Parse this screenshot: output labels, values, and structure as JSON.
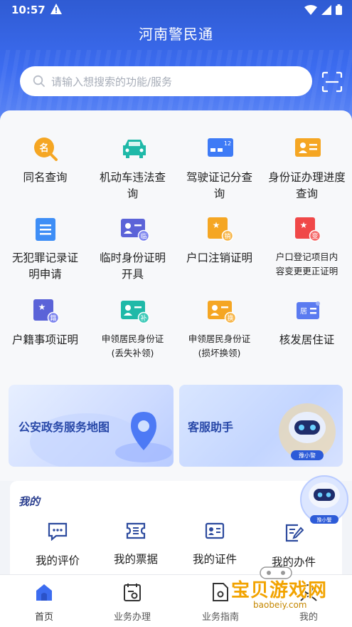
{
  "status_bar": {
    "time": "10:57"
  },
  "header": {
    "title": "河南警民通"
  },
  "search": {
    "placeholder": "请输入想搜索的功能/服务"
  },
  "services": [
    {
      "label": "同名查询",
      "icon": "search-name-icon",
      "color": "#f5a623"
    },
    {
      "label": "机动车违法查询",
      "icon": "car-icon",
      "color": "#1fb9a8"
    },
    {
      "label": "驾驶证记分查询",
      "icon": "license-icon",
      "color": "#3e7bf6",
      "badge": "12"
    },
    {
      "label": "身份证办理进度查询",
      "icon": "id-card-icon",
      "color": "#f5a623"
    },
    {
      "label": "无犯罪记录证明申请",
      "icon": "document-icon",
      "color": "#3e8ef6"
    },
    {
      "label": "临时身份证明开具",
      "icon": "temp-id-icon",
      "color": "#5b63d8",
      "badge": "临"
    },
    {
      "label": "户口注销证明",
      "icon": "household-cancel-icon",
      "color": "#f5a623",
      "badge": "销"
    },
    {
      "label": "户口登记项目内容变更更正证明",
      "icon": "household-change-icon",
      "color": "#f04848",
      "badge": "变"
    },
    {
      "label": "户籍事项证明",
      "icon": "household-record-icon",
      "color": "#5b63d8",
      "badge": "籍"
    },
    {
      "label": "申领居民身份证(丢失补领)",
      "icon": "id-reissue-icon",
      "color": "#1fb9a8",
      "badge": "补"
    },
    {
      "label": "申领居民身份证(损坏换领)",
      "icon": "id-replace-icon",
      "color": "#f5a623",
      "badge": "换"
    },
    {
      "label": "核发居住证",
      "icon": "residence-permit-icon",
      "color": "#5b7bf0",
      "badge": "居"
    }
  ],
  "banners": {
    "map": "公安政务服务地图",
    "assistant": "客服助手",
    "robot_name": "豫小警"
  },
  "mine": {
    "title": "我的",
    "items": [
      {
        "label": "我的评价",
        "icon": "comment-icon"
      },
      {
        "label": "我的票据",
        "icon": "ticket-icon"
      },
      {
        "label": "我的证件",
        "icon": "certificate-icon"
      },
      {
        "label": "我的办件",
        "icon": "edit-doc-icon"
      }
    ]
  },
  "tabbar": {
    "items": [
      {
        "label": "首页",
        "icon": "home-icon"
      },
      {
        "label": "业务办理",
        "icon": "business-icon"
      },
      {
        "label": "业务指南",
        "icon": "guide-icon"
      },
      {
        "label": "我的",
        "icon": "user-icon"
      }
    ]
  },
  "watermark": {
    "text": "宝贝游戏网",
    "sub": "baobeiy.com"
  },
  "colors": {
    "primary": "#3c6cf0",
    "accent_orange": "#f5a623",
    "accent_teal": "#1fb9a8"
  }
}
